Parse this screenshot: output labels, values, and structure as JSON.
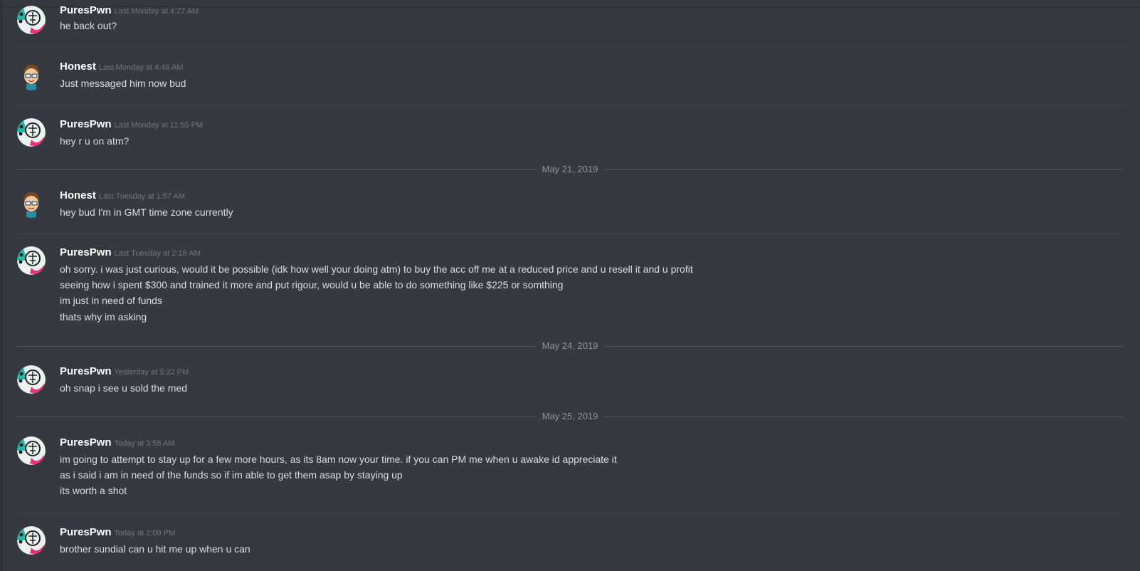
{
  "messages": [
    {
      "author": "PuresPwn",
      "timestamp": "Last Monday at 4:27 AM",
      "lines": [
        "he back out?"
      ]
    },
    {
      "author": "Honest",
      "timestamp": "Last Monday at 4:48 AM",
      "lines": [
        "Just messaged him now bud"
      ]
    },
    {
      "author": "PuresPwn",
      "timestamp": "Last Monday at 11:55 PM",
      "lines": [
        "hey r u on atm?"
      ]
    },
    {
      "author": "Honest",
      "timestamp": "Last Tuesday at 1:57 AM",
      "lines": [
        "hey bud I'm in GMT time zone currently"
      ]
    },
    {
      "author": "PuresPwn",
      "timestamp": "Last Tuesday at 2:18 AM",
      "lines": [
        "oh sorry. i was just curious, would it be possible (idk how well your doing atm) to buy the acc off me at a reduced price and u resell it and u profit",
        "seeing how i spent $300 and trained it more and put rigour, would u be able to do something like $225 or somthing",
        "im just in need of funds",
        "thats why im asking"
      ]
    },
    {
      "author": "PuresPwn",
      "timestamp": "Yesterday at 5:32 PM",
      "lines": [
        "oh snap i see u sold the med"
      ]
    },
    {
      "author": "PuresPwn",
      "timestamp": "Today at 3:58 AM",
      "lines": [
        "im going to attempt to stay up for a few more hours, as its 8am now your time. if you can PM me when u awake id appreciate it",
        "as i said i am in need of the funds so if im able to get them asap by staying up",
        "its worth a shot"
      ]
    },
    {
      "author": "PuresPwn",
      "timestamp": "Today at 2:09 PM",
      "lines": [
        "brother sundial can u hit me up when u can"
      ]
    }
  ],
  "day_dividers": [
    "May 21, 2019",
    "May 24, 2019",
    "May 25, 2019"
  ],
  "colors": {
    "background": "#36393f",
    "username": "#ffffff",
    "timestamp": "#72767d",
    "message_text": "#dcddde"
  },
  "avatars": {
    "PuresPwn": "emblem-avatar-icon",
    "Honest": "cartoon-face-avatar-icon"
  }
}
